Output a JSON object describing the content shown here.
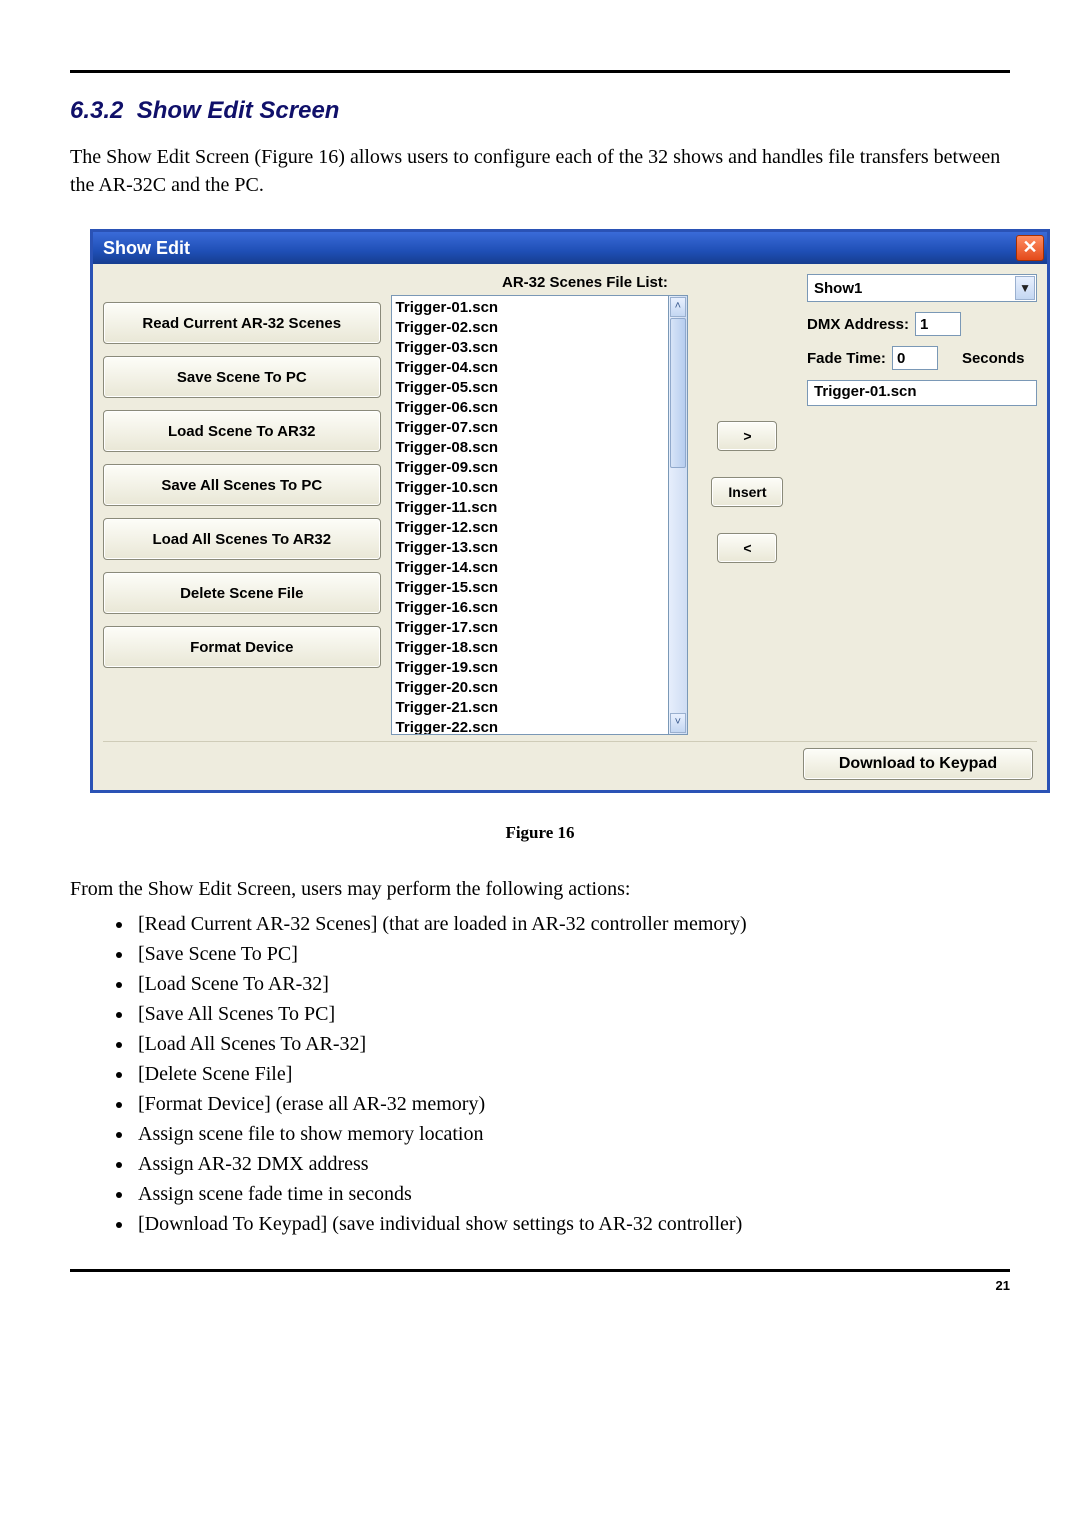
{
  "section": {
    "number": "6.3.2",
    "title": "Show Edit Screen",
    "intro": "The Show Edit Screen (Figure 16) allows users to configure each of the 32 shows and handles file transfers between the AR-32C and the PC."
  },
  "dialog": {
    "title": "Show Edit",
    "close_glyph": "✕",
    "left_buttons": [
      "Read Current AR-32 Scenes",
      "Save Scene To PC",
      "Load Scene To AR32",
      "Save All Scenes To PC",
      "Load All Scenes To AR32",
      "Delete Scene File",
      "Format Device"
    ],
    "list_label": "AR-32 Scenes File List:",
    "files": [
      "Trigger-01.scn",
      "Trigger-02.scn",
      "Trigger-03.scn",
      "Trigger-04.scn",
      "Trigger-05.scn",
      "Trigger-06.scn",
      "Trigger-07.scn",
      "Trigger-08.scn",
      "Trigger-09.scn",
      "Trigger-10.scn",
      "Trigger-11.scn",
      "Trigger-12.scn",
      "Trigger-13.scn",
      "Trigger-14.scn",
      "Trigger-15.scn",
      "Trigger-16.scn",
      "Trigger-17.scn",
      "Trigger-18.scn",
      "Trigger-19.scn",
      "Trigger-20.scn",
      "Trigger-21.scn",
      "Trigger-22.scn"
    ],
    "xfer": {
      "next": ">",
      "insert": "Insert",
      "prev": "<"
    },
    "show_select": "Show1",
    "dmx_label": "DMX Address:",
    "dmx_value": "1",
    "fade_label": "Fade Time:",
    "fade_value": "0",
    "fade_unit": "Seconds",
    "scene_slot": "Trigger-01.scn",
    "download_label": "Download to Keypad",
    "scroll": {
      "up": "˄",
      "down": "˅",
      "select": "▼"
    }
  },
  "figure_caption": "Figure 16",
  "actions_intro": "From the Show Edit Screen, users may perform the following actions:",
  "actions": [
    "[Read Current AR-32 Scenes] (that are loaded in AR-32 controller memory)",
    "[Save Scene To PC]",
    "[Load Scene To AR-32]",
    "[Save All Scenes To PC]",
    "[Load All Scenes To AR-32]",
    "[Delete Scene File]",
    "[Format Device] (erase all AR-32 memory)",
    "Assign scene file to show memory location",
    "Assign AR-32 DMX address",
    "Assign scene fade time in seconds",
    "[Download To Keypad] (save individual show settings to AR-32 controller)"
  ],
  "page_number": "21"
}
